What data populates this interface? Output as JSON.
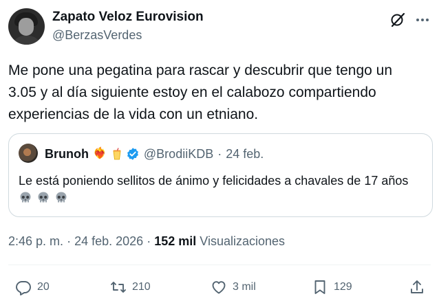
{
  "author": {
    "name": "Zapato Veloz Eurovision",
    "handle": "@BerzasVerdes"
  },
  "tweet": {
    "text": "Me pone una pegatina para rascar y descubrir que tengo un\n3.05 y al día siguiente estoy en el calabozo compartiendo\nexperiencias de la vida con un etniano."
  },
  "quoted": {
    "name": "Brunoh",
    "name_emoji_1": "❤️‍🔥",
    "name_emoji_2": "drink-cup-emoji",
    "handle": "@BrodiiKDB",
    "separator": "·",
    "date": "24 feb.",
    "text": "Le está poniendo sellitos de ánimo y felicidades a chavales de 17 años",
    "trailing_emoji": [
      "skull-emoji",
      "skull-emoji",
      "skull-emoji"
    ]
  },
  "meta": {
    "time": "2:46 p. m.",
    "separator": "·",
    "date": "24 feb. 2026",
    "views_count": "152 mil",
    "views_label": "Visualizaciones"
  },
  "actions": {
    "replies": "20",
    "reposts": "210",
    "likes": "3 mil",
    "bookmarks": "129"
  },
  "icons": {
    "grok": "grok-icon",
    "more": "more-icon",
    "verified": "verified-badge-icon",
    "reply": "reply-icon",
    "repost": "repost-icon",
    "like": "heart-icon",
    "bookmark": "bookmark-icon",
    "share": "share-icon"
  },
  "colors": {
    "text": "#0f1419",
    "secondary": "#536471",
    "border": "#cfd9de",
    "verified": "#1d9bf0"
  }
}
